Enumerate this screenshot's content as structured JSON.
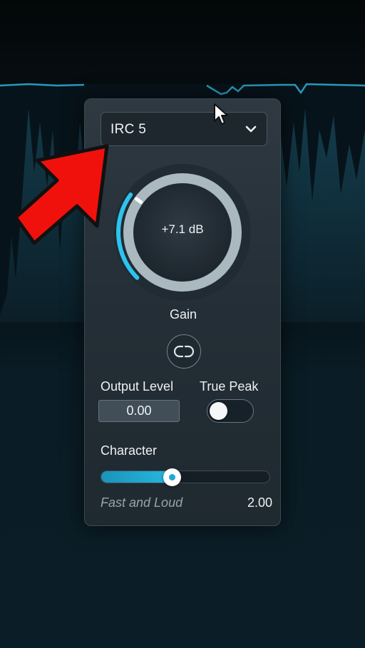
{
  "preset": {
    "value": "IRC 5"
  },
  "gain": {
    "value_text": "+7.1 dB",
    "label": "Gain",
    "level": 0.3
  },
  "output": {
    "label": "Output Level",
    "value": "0.00"
  },
  "true_peak": {
    "label": "True Peak",
    "enabled": false
  },
  "character": {
    "label": "Character",
    "mode": "Fast and Loud",
    "value": "2.00",
    "level": 0.42
  },
  "colors": {
    "accent": "#26b8e0",
    "arrow": "#f0110c",
    "panel": "#2a343c",
    "text": "#eef2f5"
  },
  "icons": [
    "chevron-down-icon",
    "link-icon",
    "arrow-pointer",
    "mouse-cursor-icon"
  ]
}
